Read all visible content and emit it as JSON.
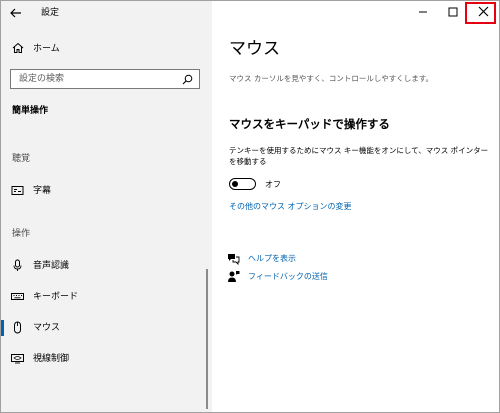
{
  "app": {
    "title": "設定"
  },
  "sidebar": {
    "home_label": "ホーム",
    "search_placeholder": "設定の検索",
    "section_title": "簡単操作",
    "groups": {
      "hearing": "聴覚",
      "interaction": "操作"
    },
    "items": [
      {
        "label": "字幕",
        "icon": "captions-icon"
      },
      {
        "label": "音声認識",
        "icon": "microphone-icon"
      },
      {
        "label": "キーボード",
        "icon": "keyboard-icon"
      },
      {
        "label": "マウス",
        "icon": "mouse-icon",
        "selected": true
      },
      {
        "label": "視線制御",
        "icon": "eye-control-icon"
      }
    ]
  },
  "window_controls": {
    "minimize": "—",
    "maximize": "☐",
    "close": "✕"
  },
  "main": {
    "title": "マウス",
    "description": "マウス カーソルを見やすく、コントロールしやすくします。",
    "subheading": "マウスをキーパッドで操作する",
    "setting_description": "テンキーを使用するためにマウス キー機能をオンにして、マウス ポインターを移動する",
    "toggle_state": "オフ",
    "toggle_on": false,
    "link_other": "その他のマウス オプションの変更",
    "help_links": [
      {
        "label": "ヘルプを表示",
        "icon": "help-icon"
      },
      {
        "label": "フィードバックの送信",
        "icon": "feedback-icon"
      }
    ]
  },
  "colors": {
    "accent": "#0063b1",
    "highlight": "#e60012",
    "sidebar_bg": "#f2f2f2"
  }
}
